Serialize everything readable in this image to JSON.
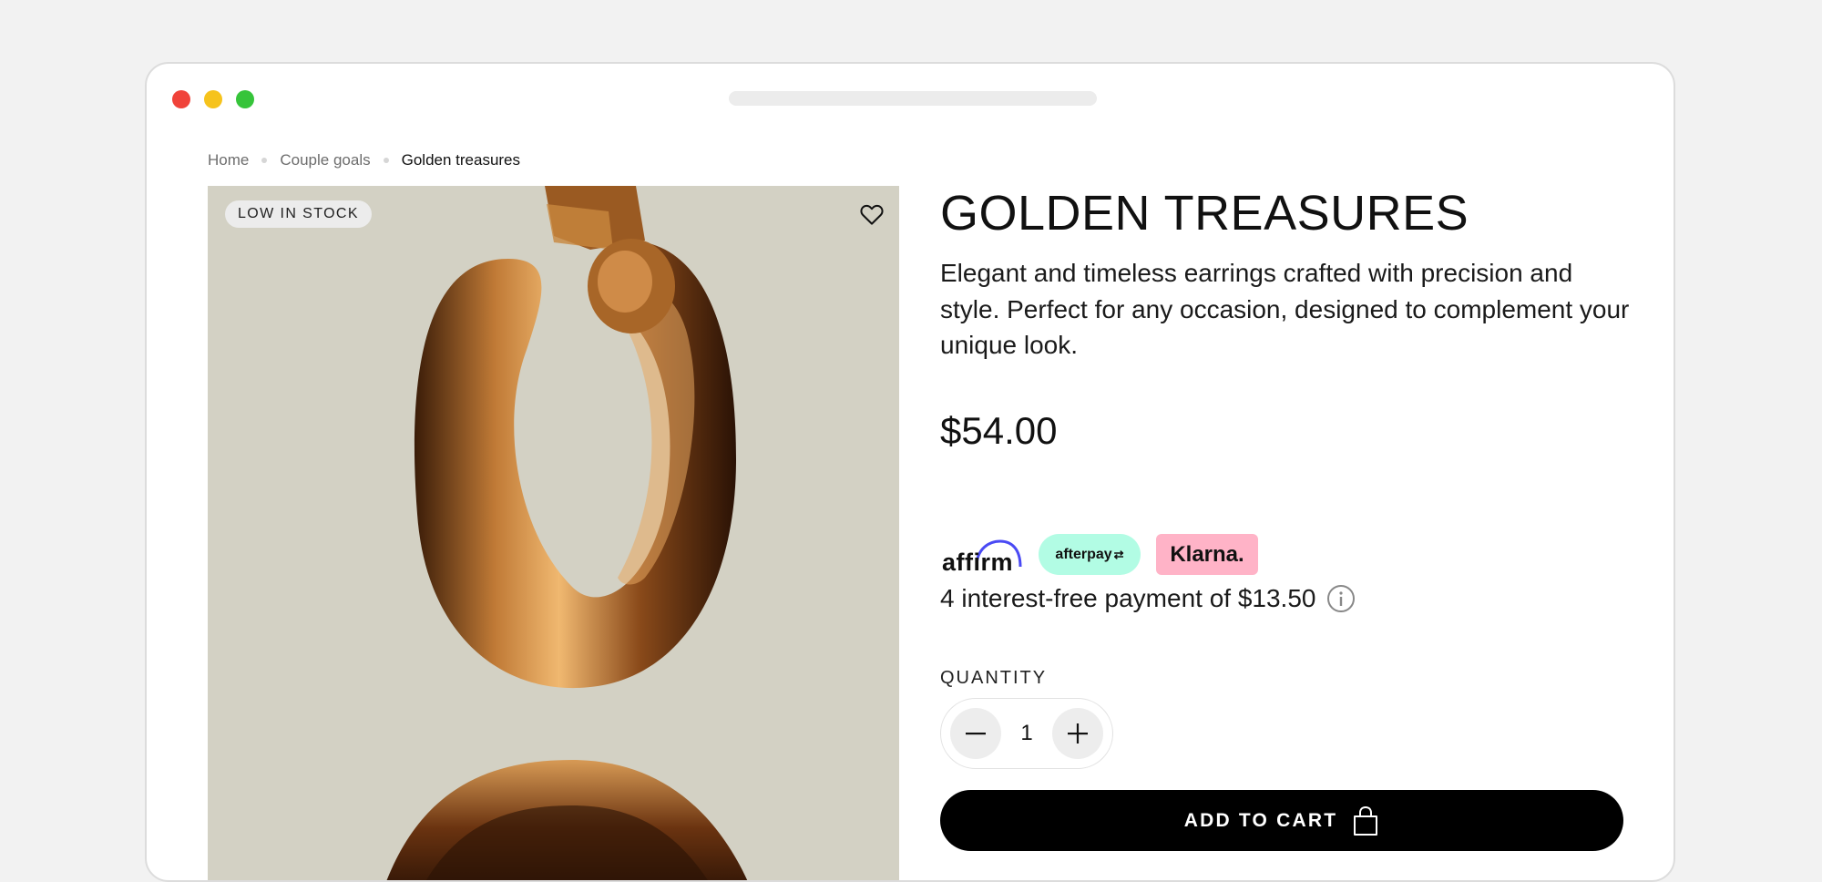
{
  "breadcrumb": {
    "items": [
      "Home",
      "Couple goals"
    ],
    "current": "Golden treasures"
  },
  "product": {
    "stock_badge": "LOW IN STOCK",
    "title": "GOLDEN TREASURES",
    "description": "Elegant and timeless earrings crafted with precision and style. Perfect for any occasion, designed to complement your unique look.",
    "price": "$54.00",
    "payment_providers": [
      "affirm",
      "afterpay",
      "Klarna."
    ],
    "installment_text": "4 interest-free payment of $13.50",
    "quantity_label": "QUANTITY",
    "quantity": "1",
    "add_to_cart_label": "ADD TO CART"
  },
  "icons": [
    "heart-icon",
    "info-icon",
    "minus-icon",
    "plus-icon",
    "shopping-bag-icon"
  ],
  "colors": {
    "afterpay_bg": "#b2fce4",
    "klarna_bg": "#ffb3c7",
    "affirm_arc": "#4a4af4",
    "gold": "#b36b2a",
    "image_bg": "#d3d1c4",
    "cart_button": "#000000"
  }
}
